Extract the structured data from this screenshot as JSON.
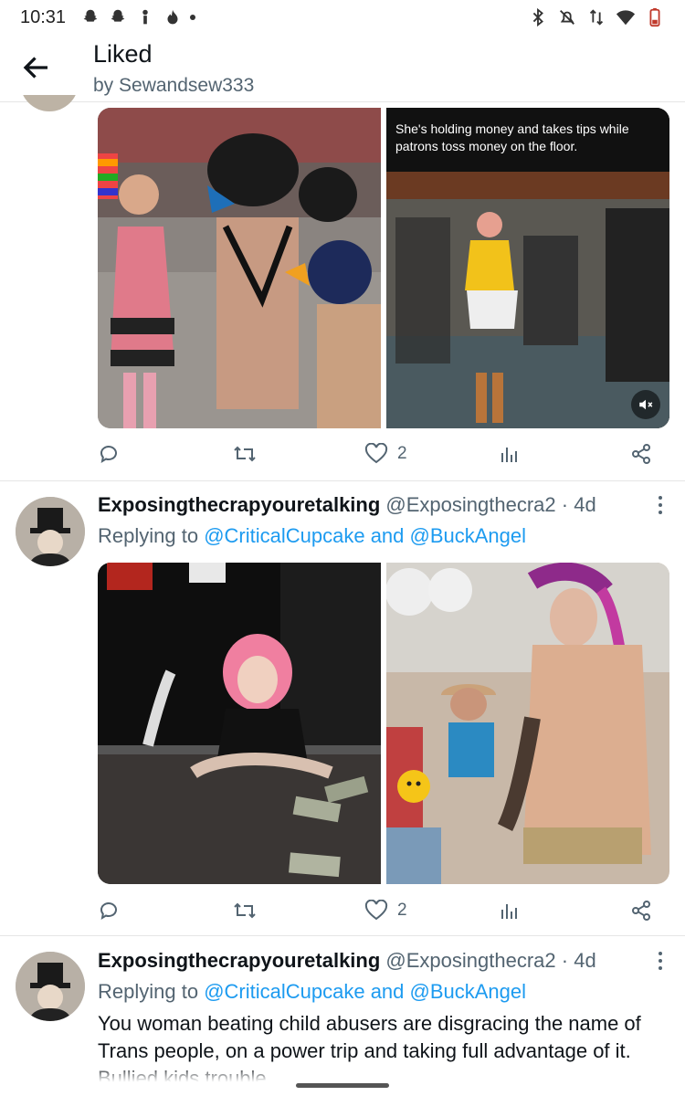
{
  "status_bar": {
    "time": "10:31"
  },
  "header": {
    "title": "Liked",
    "subtitle": "by Sewandsew333"
  },
  "post1": {
    "video_caption": "She's holding money and takes tips while patrons toss money on the floor.",
    "likes": "2"
  },
  "post2": {
    "display_name": "Exposingthecrapyouretalking",
    "handle": "@Exposingthecra2",
    "separator": " · ",
    "time": "4d",
    "replying_prefix": "Replying to ",
    "mention1": "@CriticalCupcake",
    "and_word": " and ",
    "mention2": "@BuckAngel",
    "likes": "2"
  },
  "post3": {
    "display_name": "Exposingthecrapyouretalking",
    "handle": "@Exposingthecra2",
    "separator": " · ",
    "time": "4d",
    "replying_prefix": "Replying to ",
    "mention1": "@CriticalCupcake",
    "and_word": " and ",
    "mention2": "@BuckAngel",
    "text": "You woman beating child abusers are disgracing the name of Trans people, on a power trip and taking full advantage of it. Bullied kids trouble"
  },
  "icons": [
    "back-arrow-icon",
    "reply-icon",
    "retweet-icon",
    "like-icon",
    "views-icon",
    "share-icon",
    "more-vertical-icon",
    "volume-mute-icon",
    "bluetooth-icon",
    "mute-bell-icon",
    "wifi-icon",
    "battery-icon"
  ],
  "colors": {
    "link": "#1d9bf0",
    "secondary_text": "#536471",
    "primary_text": "#0f1419",
    "divider": "#e6e6e6"
  }
}
